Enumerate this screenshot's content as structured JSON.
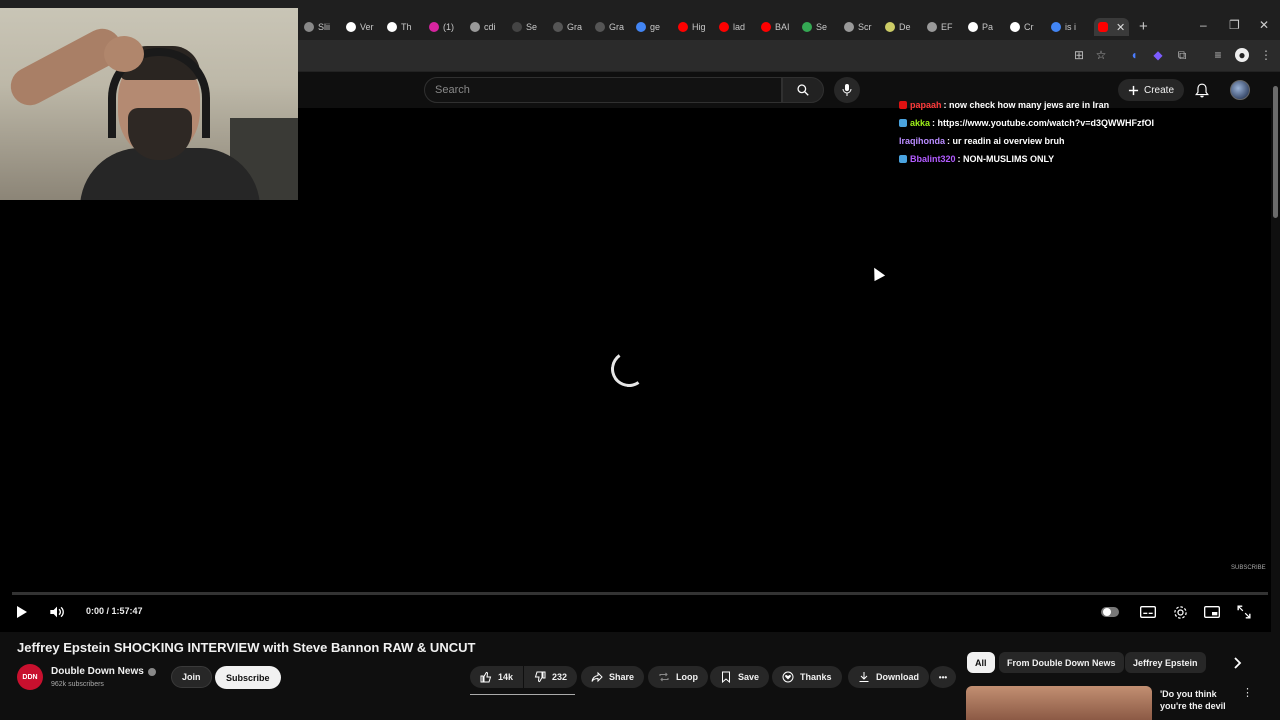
{
  "browser": {
    "tabs": [
      {
        "label": "Slii",
        "icon_color": "#888"
      },
      {
        "label": "Ver",
        "icon_color": "#ffffff"
      },
      {
        "label": "Th",
        "icon_color": "#ffffff"
      },
      {
        "label": "(1)",
        "icon_color": "#d6249f"
      },
      {
        "label": "cdi",
        "icon_color": "#999999"
      },
      {
        "label": "Se",
        "icon_color": "#444444"
      },
      {
        "label": "Gra",
        "icon_color": "#555555"
      },
      {
        "label": "Gra",
        "icon_color": "#555555"
      },
      {
        "label": "ge",
        "icon_color": "#4285f4"
      },
      {
        "label": "Hig",
        "icon_color": "#ff0000"
      },
      {
        "label": "lad",
        "icon_color": "#ff0000"
      },
      {
        "label": "BAI",
        "icon_color": "#ff0000"
      },
      {
        "label": "Se",
        "icon_color": "#34a853"
      },
      {
        "label": "Scr",
        "icon_color": "#999999"
      },
      {
        "label": "De",
        "icon_color": "#cccc66"
      },
      {
        "label": "EF",
        "icon_color": "#999999"
      },
      {
        "label": "Pa",
        "icon_color": "#ffffff"
      },
      {
        "label": "Cr",
        "icon_color": "#ffffff"
      },
      {
        "label": "is i",
        "icon_color": "#4285f4"
      }
    ],
    "active_tab_label": "",
    "new_tab": "+",
    "minimize": "–",
    "restore": "❐",
    "close": "✕"
  },
  "masthead": {
    "search_placeholder": "Search",
    "create_label": "Create"
  },
  "chat": [
    {
      "user": "papaah",
      "message": ": now check how many jews are in Iran",
      "color": "#ff3b3b",
      "badge_color": "#d11"
    },
    {
      "user": "akka",
      "message": ": https://www.youtube.com/watch?v=d3QWWHFzfOI",
      "color": "#9ef01a",
      "badge_color": "#4aa3df"
    },
    {
      "user": "Iraqihonda",
      "message": ": ur readin ai overview bruh",
      "color": "#b98cff",
      "badge_color": ""
    },
    {
      "user": "Bbalint320",
      "message": ": NON-MUSLIMS ONLY",
      "color": "#b25cff",
      "badge_color": "#4aa3df"
    }
  ],
  "player": {
    "watermark": "SUBSCRIBE",
    "timecode": "0:00 / 1:57:47",
    "progress": 0
  },
  "video": {
    "title": "Jeffrey Epstein SHOCKING INTERVIEW with Steve Bannon RAW & UNCUT",
    "channel": "Double Down News",
    "channel_avatar": "DDN",
    "subscribers": "962k subscribers",
    "join_label": "Join",
    "subscribe_label": "Subscribe",
    "likes": "14k",
    "dislikes": "232",
    "share_label": "Share",
    "loop_label": "Loop",
    "save_label": "Save",
    "thanks_label": "Thanks",
    "download_label": "Download",
    "more_label": "•••"
  },
  "chips": [
    "All",
    "From Double Down News",
    "Jeffrey Epstein"
  ],
  "recommendation": {
    "title": "'Do you think you're the devil"
  },
  "colors": {
    "page_bg": "#000000",
    "yt_bg": "#0f0f0f",
    "button_bg": "#272727",
    "accent_red": "#ff0000"
  }
}
